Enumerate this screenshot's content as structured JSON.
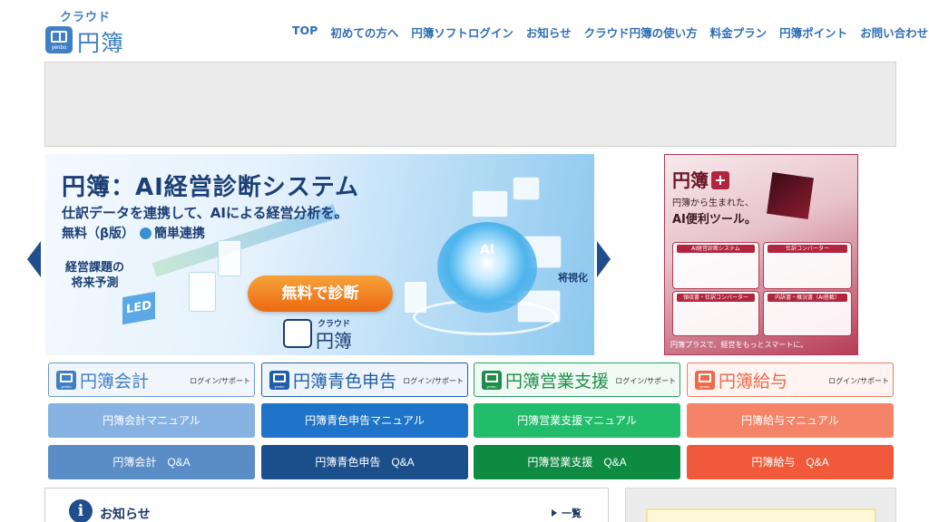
{
  "header": {
    "logo_kana": "クラウド",
    "logo_text": "円簿",
    "logo_small": "yenbo",
    "nav": [
      {
        "label": "TOP"
      },
      {
        "label": "初めての方へ"
      },
      {
        "label": "円簿ソフトログイン"
      },
      {
        "label": "お知らせ"
      },
      {
        "label": "クラウド円簿の使い方"
      },
      {
        "label": "料金プラン"
      },
      {
        "label": "円簿ポイント"
      },
      {
        "label": "お問い合わせ"
      }
    ]
  },
  "main_banner": {
    "title": "円簿：AI経営診断システム",
    "subtitle": "仕訳データを連携して、AIによる経営分析を。",
    "free_line": "無料（β版）",
    "easy_link": "簡単連携",
    "issue": "経営課題の",
    "issue2": "将来予測",
    "visualize": "将視化",
    "cta": "無料で診断",
    "ai_label": "AI",
    "led": "LED",
    "logo_kana": "クラウド",
    "logo_text": "円簿"
  },
  "side_banner": {
    "title": "円簿",
    "plus": "+",
    "sub1": "円簿から生まれた、",
    "sub2": "AI便利ツール。",
    "panels": [
      {
        "label": "AI経営診断システム"
      },
      {
        "label": "仕訳コンバーター"
      },
      {
        "label": "領収書・仕訳コンバーター"
      },
      {
        "label": "内訳書・概況書（AI搭載）"
      }
    ],
    "footer": "円簿プラスで、経営をもっとスマートに。"
  },
  "products": [
    {
      "name": "円簿会計",
      "login": "ログイン/サポート",
      "manual": "円簿会計マニュアル",
      "qa": "円簿会計　Q&A"
    },
    {
      "name": "円簿青色申告",
      "login": "ログイン/サポート",
      "manual": "円簿青色申告マニュアル",
      "qa": "円簿青色申告　Q&A"
    },
    {
      "name": "円簿営業支援",
      "login": "ログイン/サポート",
      "manual": "円簿営業支援マニュアル",
      "qa": "円簿営業支援　Q&A"
    },
    {
      "name": "円簿給与",
      "login": "ログイン/サポート",
      "manual": "円簿給与マニュアル",
      "qa": "円簿給与　Q&A"
    }
  ],
  "news": {
    "icon": "i",
    "title": "お知らせ",
    "view_all": "一覧"
  }
}
